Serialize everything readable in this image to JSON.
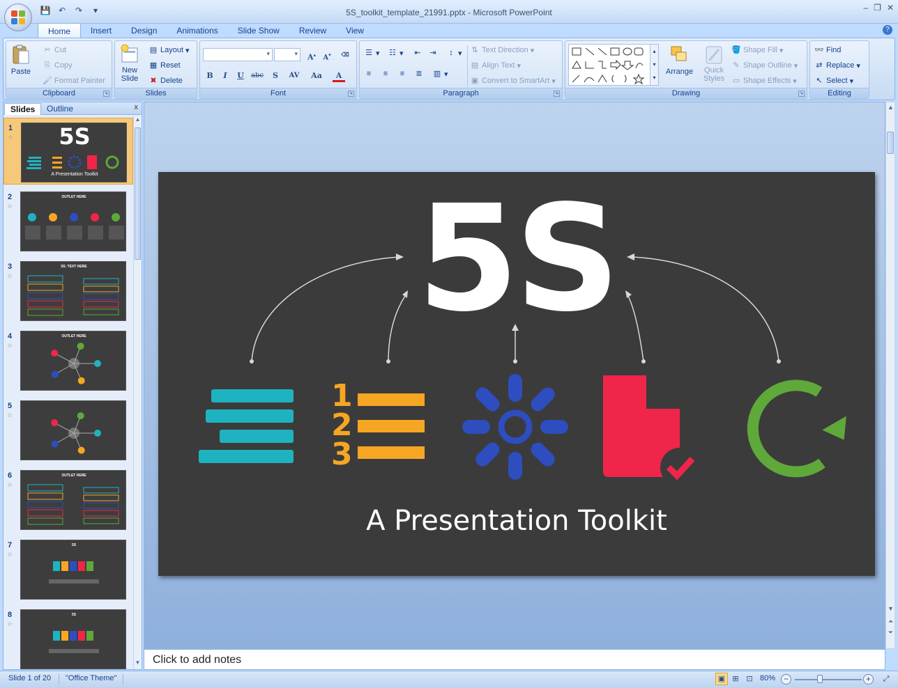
{
  "window": {
    "title": "5S_toolkit_template_21991.pptx - Microsoft PowerPoint"
  },
  "ribbon_tabs": [
    "Home",
    "Insert",
    "Design",
    "Animations",
    "Slide Show",
    "Review",
    "View"
  ],
  "ribbon": {
    "clipboard": {
      "label": "Clipboard",
      "paste": "Paste",
      "cut": "Cut",
      "copy": "Copy",
      "format_painter": "Format Painter"
    },
    "slides": {
      "label": "Slides",
      "new_slide": "New",
      "new_slide_2": "Slide",
      "layout": "Layout",
      "reset": "Reset",
      "delete": "Delete"
    },
    "font": {
      "label": "Font",
      "bold": "B",
      "italic": "I",
      "underline": "U",
      "strike": "abc",
      "shadow": "S",
      "spacing": "AV",
      "case": "Aa",
      "color": "A"
    },
    "paragraph": {
      "label": "Paragraph",
      "text_direction": "Text Direction",
      "align_text": "Align Text",
      "convert_smartart": "Convert to SmartArt"
    },
    "drawing": {
      "label": "Drawing",
      "arrange": "Arrange",
      "quick_styles": "Quick",
      "quick_styles_2": "Styles",
      "shape_fill": "Shape Fill",
      "shape_outline": "Shape Outline",
      "shape_effects": "Shape Effects"
    },
    "editing": {
      "label": "Editing",
      "find": "Find",
      "replace": "Replace",
      "select": "Select"
    }
  },
  "slides_pane": {
    "tab_slides": "Slides",
    "tab_outline": "Outline",
    "close": "x",
    "thumbnails": [
      {
        "num": "1",
        "title": "5S",
        "subtitle": "A Presentation Toolkit"
      },
      {
        "num": "2",
        "title": "OUTLET HERE"
      },
      {
        "num": "3",
        "title": "5S: TEXT HERE"
      },
      {
        "num": "4",
        "title": "OUTLET HERE"
      },
      {
        "num": "5",
        "title": ""
      },
      {
        "num": "6",
        "title": "OUTLET HERE"
      },
      {
        "num": "7",
        "title": "5S"
      },
      {
        "num": "8",
        "title": "5S"
      }
    ]
  },
  "slide": {
    "title": "5S",
    "subtitle": "A Presentation Toolkit"
  },
  "notes": {
    "placeholder": "Click to add notes"
  },
  "status": {
    "slide_info": "Slide 1 of 20",
    "theme": "\"Office Theme\"",
    "zoom": "80%"
  },
  "colors": {
    "teal": "#1fb3c1",
    "orange": "#f6a623",
    "blue": "#2e4dbf",
    "red": "#f0254a",
    "green": "#5fa83a",
    "slide_bg": "#3b3b3b"
  }
}
